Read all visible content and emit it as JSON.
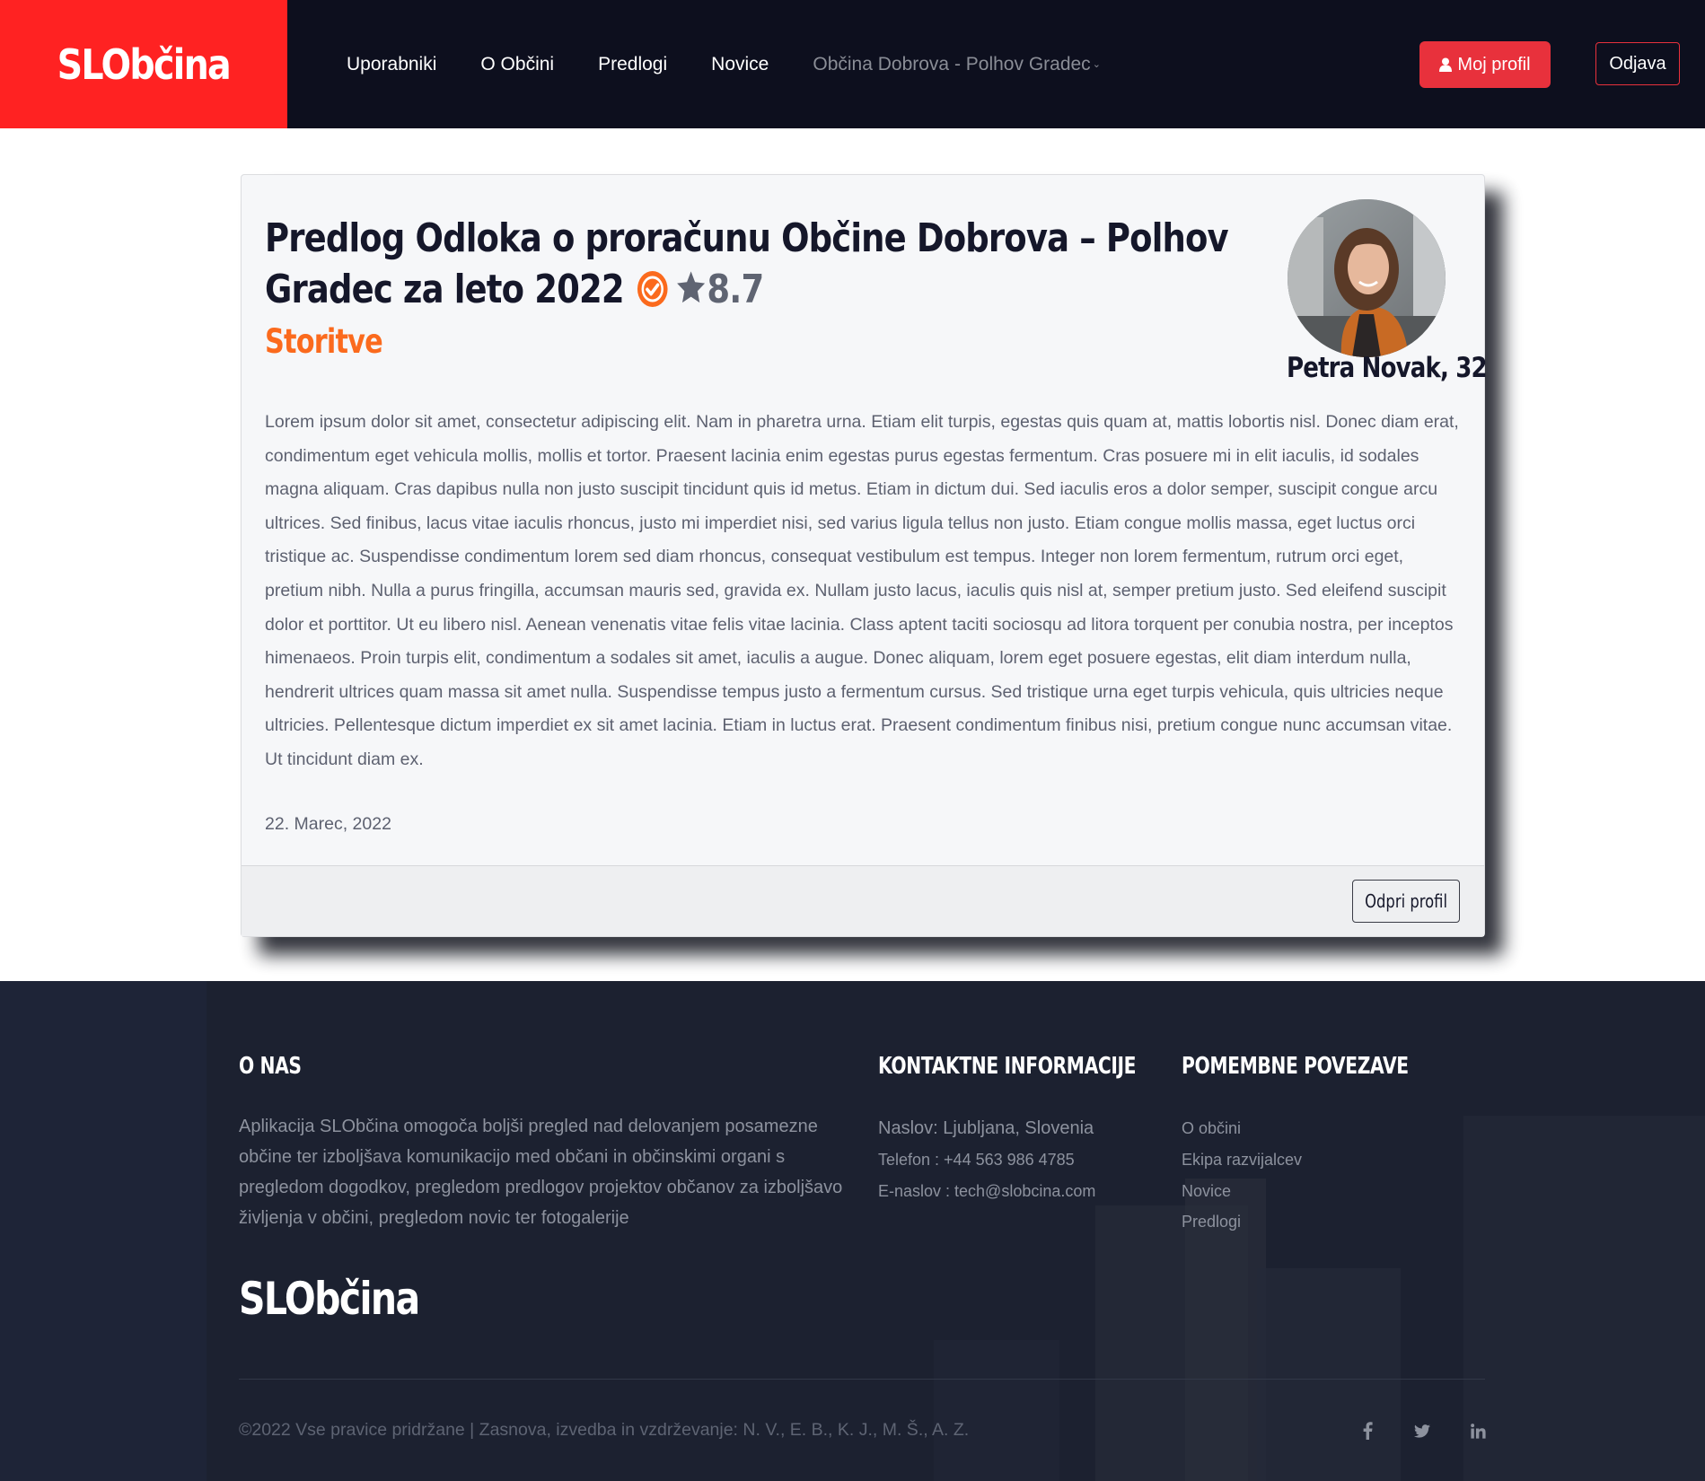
{
  "navbar": {
    "brand": "SLObčina",
    "links": [
      "Uporabniki",
      "O Občini",
      "Predlogi",
      "Novice"
    ],
    "municipality": "Občina Dobrova - Polhov Gradec",
    "profile_button": "Moj profil",
    "logout_button": "Odjava"
  },
  "proposal": {
    "title": "Predlog Odloka o proračunu Občine Dobrova – Polhov Gradec za leto 2022",
    "rating": "8.7",
    "category": "Storitve",
    "author": "Petra Novak, 32",
    "body": "Lorem ipsum dolor sit amet, consectetur adipiscing elit. Nam in pharetra urna. Etiam elit turpis, egestas quis quam at, mattis lobortis nisl. Donec diam erat, condimentum eget vehicula mollis, mollis et tortor. Praesent lacinia enim egestas purus egestas fermentum. Cras posuere mi in elit iaculis, id sodales magna aliquam. Cras dapibus nulla non justo suscipit tincidunt quis id metus. Etiam in dictum dui. Sed iaculis eros a dolor semper, suscipit congue arcu ultrices. Sed finibus, lacus vitae iaculis rhoncus, justo mi imperdiet nisi, sed varius ligula tellus non justo. Etiam congue mollis massa, eget luctus orci tristique ac. Suspendisse condimentum lorem sed diam rhoncus, consequat vestibulum est tempus. Integer non lorem fermentum, rutrum orci eget, pretium nibh. Nulla a purus fringilla, accumsan mauris sed, gravida ex. Nullam justo lacus, iaculis quis nisl at, semper pretium justo. Sed eleifend suscipit dolor et porttitor. Ut eu libero nisl. Aenean venenatis vitae felis vitae lacinia. Class aptent taciti sociosqu ad litora torquent per conubia nostra, per inceptos himenaeos. Proin turpis elit, condimentum a sodales sit amet, iaculis a augue. Donec aliquam, lorem eget posuere egestas, elit diam interdum nulla, hendrerit ultrices quam massa sit amet nulla. Suspendisse tempus justo a fermentum cursus. Sed tristique urna eget turpis vehicula, quis ultricies neque ultricies. Pellentesque dictum imperdiet ex sit amet lacinia. Etiam in luctus erat. Praesent condimentum finibus nisi, pretium congue nunc accumsan vitae. Ut tincidunt diam ex.",
    "date": "22. Marec, 2022",
    "open_profile_button": "Odpri profil"
  },
  "footer": {
    "about_heading": "O NAS",
    "about_text": "Aplikacija SLObčina omogoča boljši pregled nad delovanjem posamezne občine ter izboljšava komunikacijo med občani in občinskimi organi s pregledom dogodkov, pregledom predlogov projektov občanov za izboljšavo življenja v občini, pregledom novic ter fotogalerije",
    "contact_heading": "KONTAKTNE INFORMACIJE",
    "contact_lines": [
      "Naslov: Ljubljana, Slovenia",
      "Telefon : +44 563 986 4785",
      "E-naslov : tech@slobcina.com"
    ],
    "links_heading": "POMEMBNE POVEZAVE",
    "links": [
      "O občini",
      "Ekipa razvijalcev",
      "Novice",
      "Predlogi"
    ],
    "brand": "SLObčina",
    "copyright": "©2022 Vse pravice pridržane | Zasnova, izvedba in vzdrževanje: N. V., E. B., K. J., M. Š., A. Z.",
    "social_icons": [
      "facebook-icon",
      "twitter-icon",
      "linkedin-icon"
    ]
  },
  "colors": {
    "brand_red": "#ff2222",
    "button_red": "#e8313c",
    "accent_orange": "#fb6a1d",
    "navbar_bg": "#0d0f1e",
    "footer_bg": "#1c2130"
  }
}
